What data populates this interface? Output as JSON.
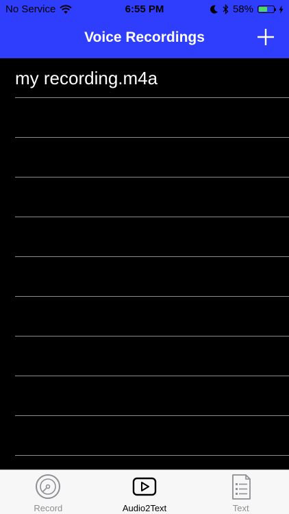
{
  "status_bar": {
    "carrier": "No Service",
    "time": "6:55 PM",
    "battery_percent": "58%",
    "battery_level": 0.58,
    "icons": [
      "wifi-icon",
      "moon-icon",
      "bluetooth-icon",
      "battery-icon",
      "charging-bolt-icon"
    ]
  },
  "nav": {
    "title": "Voice Recordings",
    "add_icon": "plus-icon"
  },
  "list": {
    "items": [
      {
        "label": "my recording.m4a"
      }
    ],
    "empty_rows": 9
  },
  "tabs": [
    {
      "label": "Record",
      "icon": "record-disc-icon",
      "active": false
    },
    {
      "label": "Audio2Text",
      "icon": "play-button-icon",
      "active": true
    },
    {
      "label": "Text",
      "icon": "text-document-icon",
      "active": false
    }
  ],
  "colors": {
    "header": "#2f3dfc",
    "background": "#000000",
    "separator": "#8c8c8c",
    "tab_bar": "#f7f7f7",
    "battery": "#4cd964"
  }
}
